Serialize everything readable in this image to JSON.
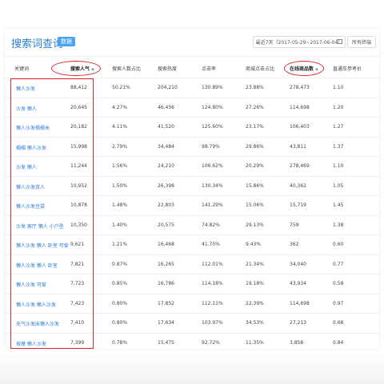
{
  "header": {
    "title": "搜索词查询",
    "tag": "数据",
    "date_range": "最近7天（2017-05-29~2017-06-04）",
    "sort_select": "所有终端"
  },
  "columns": [
    {
      "label": "关键词",
      "sort": ""
    },
    {
      "label": "搜索人气",
      "sort": "◆"
    },
    {
      "label": "搜索人数占比",
      "sort": ""
    },
    {
      "label": "搜索热度",
      "sort": ""
    },
    {
      "label": "点击率",
      "sort": ""
    },
    {
      "label": "商城点击占比",
      "sort": ""
    },
    {
      "label": "在线商品数",
      "sort": "◆"
    },
    {
      "label": "直通车参考价",
      "sort": ""
    }
  ],
  "rows": [
    [
      "懒人沙发",
      "88,412",
      "50.21%",
      "204,210",
      "130.89%",
      "23.88%",
      "278,473",
      "1.10"
    ],
    [
      "沙发 懒人",
      "20,645",
      "4.27%",
      "46,456",
      "124.80%",
      "27.26%",
      "114,698",
      "1.20"
    ],
    [
      "懒人沙发榻榻米",
      "20,182",
      "4.11%",
      "41,520",
      "125.60%",
      "23.17%",
      "106,403",
      "1.27"
    ],
    [
      "榻榻 懒人沙发",
      "15,998",
      "2.79%",
      "34,484",
      "98.79%",
      "29.86%",
      "43,811",
      "1.37"
    ],
    [
      "沙发 懒人",
      "11,244",
      "1.56%",
      "24,210",
      "106.62%",
      "20.29%",
      "278,469",
      "1.10"
    ],
    [
      "懒人沙发双人",
      "10,952",
      "1.50%",
      "26,398",
      "130.34%",
      "15.86%",
      "40,362",
      "1.05"
    ],
    [
      "懒人沙发豆袋",
      "10,878",
      "1.48%",
      "22,803",
      "141.29%",
      "15.06%",
      "15,719",
      "1.45"
    ],
    [
      "沙发 客厅 懒人 小户型",
      "10,350",
      "1.40%",
      "20,575",
      "74.82%",
      "29.13%",
      "759",
      "1.38"
    ],
    [
      "懒人沙发 懒人 卧室 可爱",
      "9,621",
      "1.21%",
      "16,468",
      "41.75%",
      "9.43%",
      "362",
      "0.60"
    ],
    [
      "懒人沙发 懒人 卧室",
      "7,821",
      "0.87%",
      "16,265",
      "112.01%",
      "21.34%",
      "34,040",
      "0.77"
    ],
    [
      "懒人沙发 可爱",
      "7,723",
      "0.85%",
      "16,786",
      "114.18%",
      "19.18%",
      "43,934",
      "0.58"
    ],
    [
      "懒人沙发 懒人沙发",
      "7,423",
      "0.80%",
      "17,852",
      "112.11%",
      "22.39%",
      "114,698",
      "0.97"
    ],
    [
      "充气沙发床懒人沙发",
      "7,410",
      "0.80%",
      "17,634",
      "103.97%",
      "34.53%",
      "27,213",
      "0.68"
    ],
    [
      "按摩 懒人沙发",
      "7,399",
      "0.78%",
      "15,475",
      "92.72%",
      "11.35%",
      "3,858",
      "0.84"
    ]
  ],
  "colors": {
    "accent": "#2d7fd1",
    "highlight": "#d9282f"
  }
}
